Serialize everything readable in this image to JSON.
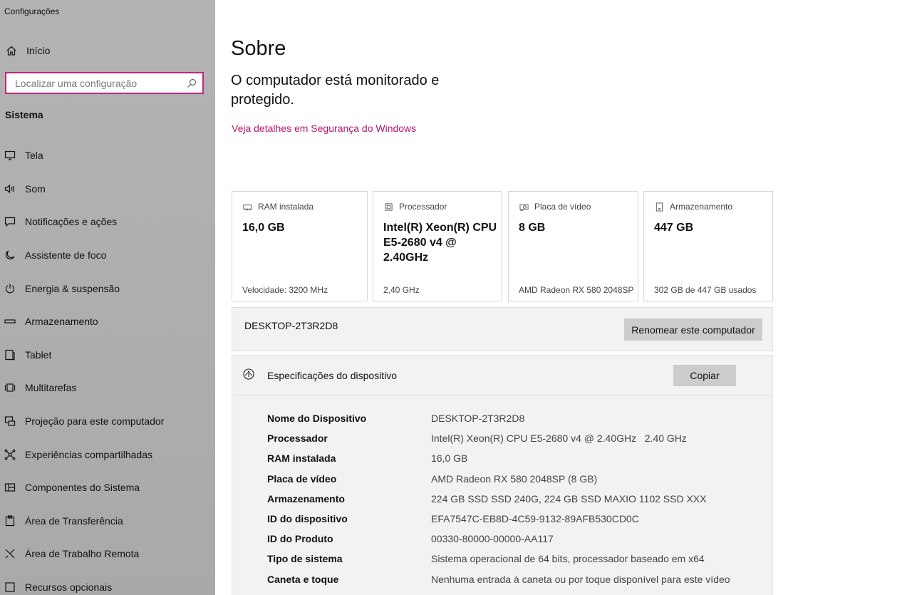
{
  "window": {
    "title": "Configurações"
  },
  "sidebar": {
    "home_label": "Início",
    "search_placeholder": "Localizar uma configuração",
    "section_title": "Sistema",
    "items": [
      {
        "label": "Tela",
        "icon": "monitor-icon"
      },
      {
        "label": "Som",
        "icon": "speaker-icon"
      },
      {
        "label": "Notificações e ações",
        "icon": "notification-icon"
      },
      {
        "label": "Assistente de foco",
        "icon": "moon-icon"
      },
      {
        "label": "Energia & suspensão",
        "icon": "power-icon"
      },
      {
        "label": "Armazenamento",
        "icon": "storage-icon"
      },
      {
        "label": "Tablet",
        "icon": "tablet-icon"
      },
      {
        "label": "Multitarefas",
        "icon": "multitask-icon"
      },
      {
        "label": "Projeção para este computador",
        "icon": "projection-icon"
      },
      {
        "label": "Experiências compartilhadas",
        "icon": "shared-icon"
      },
      {
        "label": "Componentes do Sistema",
        "icon": "components-icon"
      },
      {
        "label": "Área de Transferência",
        "icon": "clipboard-icon"
      },
      {
        "label": "Área de Trabalho Remota",
        "icon": "remote-icon"
      },
      {
        "label": "Recursos opcionais",
        "icon": "optional-icon"
      }
    ]
  },
  "main": {
    "title": "Sobre",
    "status": "O computador está monitorado e protegido.",
    "security_link": "Veja detalhes em Segurança do Windows",
    "cards": [
      {
        "label": "RAM instalada",
        "value": "16,0 GB",
        "footer": "Velocidade: 3200 MHz",
        "icon": "ram-icon"
      },
      {
        "label": "Processador",
        "value": "Intel(R) Xeon(R) CPU E5-2680 v4 @ 2.40GHz",
        "footer": "2,40 GHz",
        "icon": "cpu-icon"
      },
      {
        "label": "Placa de vídeo",
        "value": "8 GB",
        "footer": "AMD Radeon RX 580 2048SP",
        "icon": "gpu-icon"
      },
      {
        "label": "Armazenamento",
        "value": "447 GB",
        "footer": "302 GB de 447 GB usados",
        "icon": "disk-icon"
      }
    ],
    "device_name": "DESKTOP-2T3R2D8",
    "rename_button": "Renomear este computador",
    "specs": {
      "title": "Especificações do dispositivo",
      "copy_button": "Copiar",
      "rows": [
        {
          "label": "Nome do Dispositivo",
          "value": "DESKTOP-2T3R2D8"
        },
        {
          "label": "Processador",
          "value": "Intel(R) Xeon(R) CPU E5-2680 v4 @ 2.40GHz   2.40 GHz"
        },
        {
          "label": "RAM instalada",
          "value": "16,0 GB"
        },
        {
          "label": "Placa de vídeo",
          "value": "AMD Radeon RX 580 2048SP (8 GB)"
        },
        {
          "label": "Armazenamento",
          "value": "224 GB SSD SSD 240G, 224 GB SSD MAXIO 1102 SSD XXX"
        },
        {
          "label": "ID do dispositivo",
          "value": "EFA7547C-EB8D-4C59-9132-89AFB530CD0C"
        },
        {
          "label": "ID do Produto",
          "value": "00330-80000-00000-AA117"
        },
        {
          "label": "Tipo de sistema",
          "value": "Sistema operacional de 64 bits, processador baseado em x64"
        },
        {
          "label": "Caneta e toque",
          "value": "Nenhuma entrada à caneta ou por toque disponível para este vídeo"
        }
      ]
    }
  }
}
